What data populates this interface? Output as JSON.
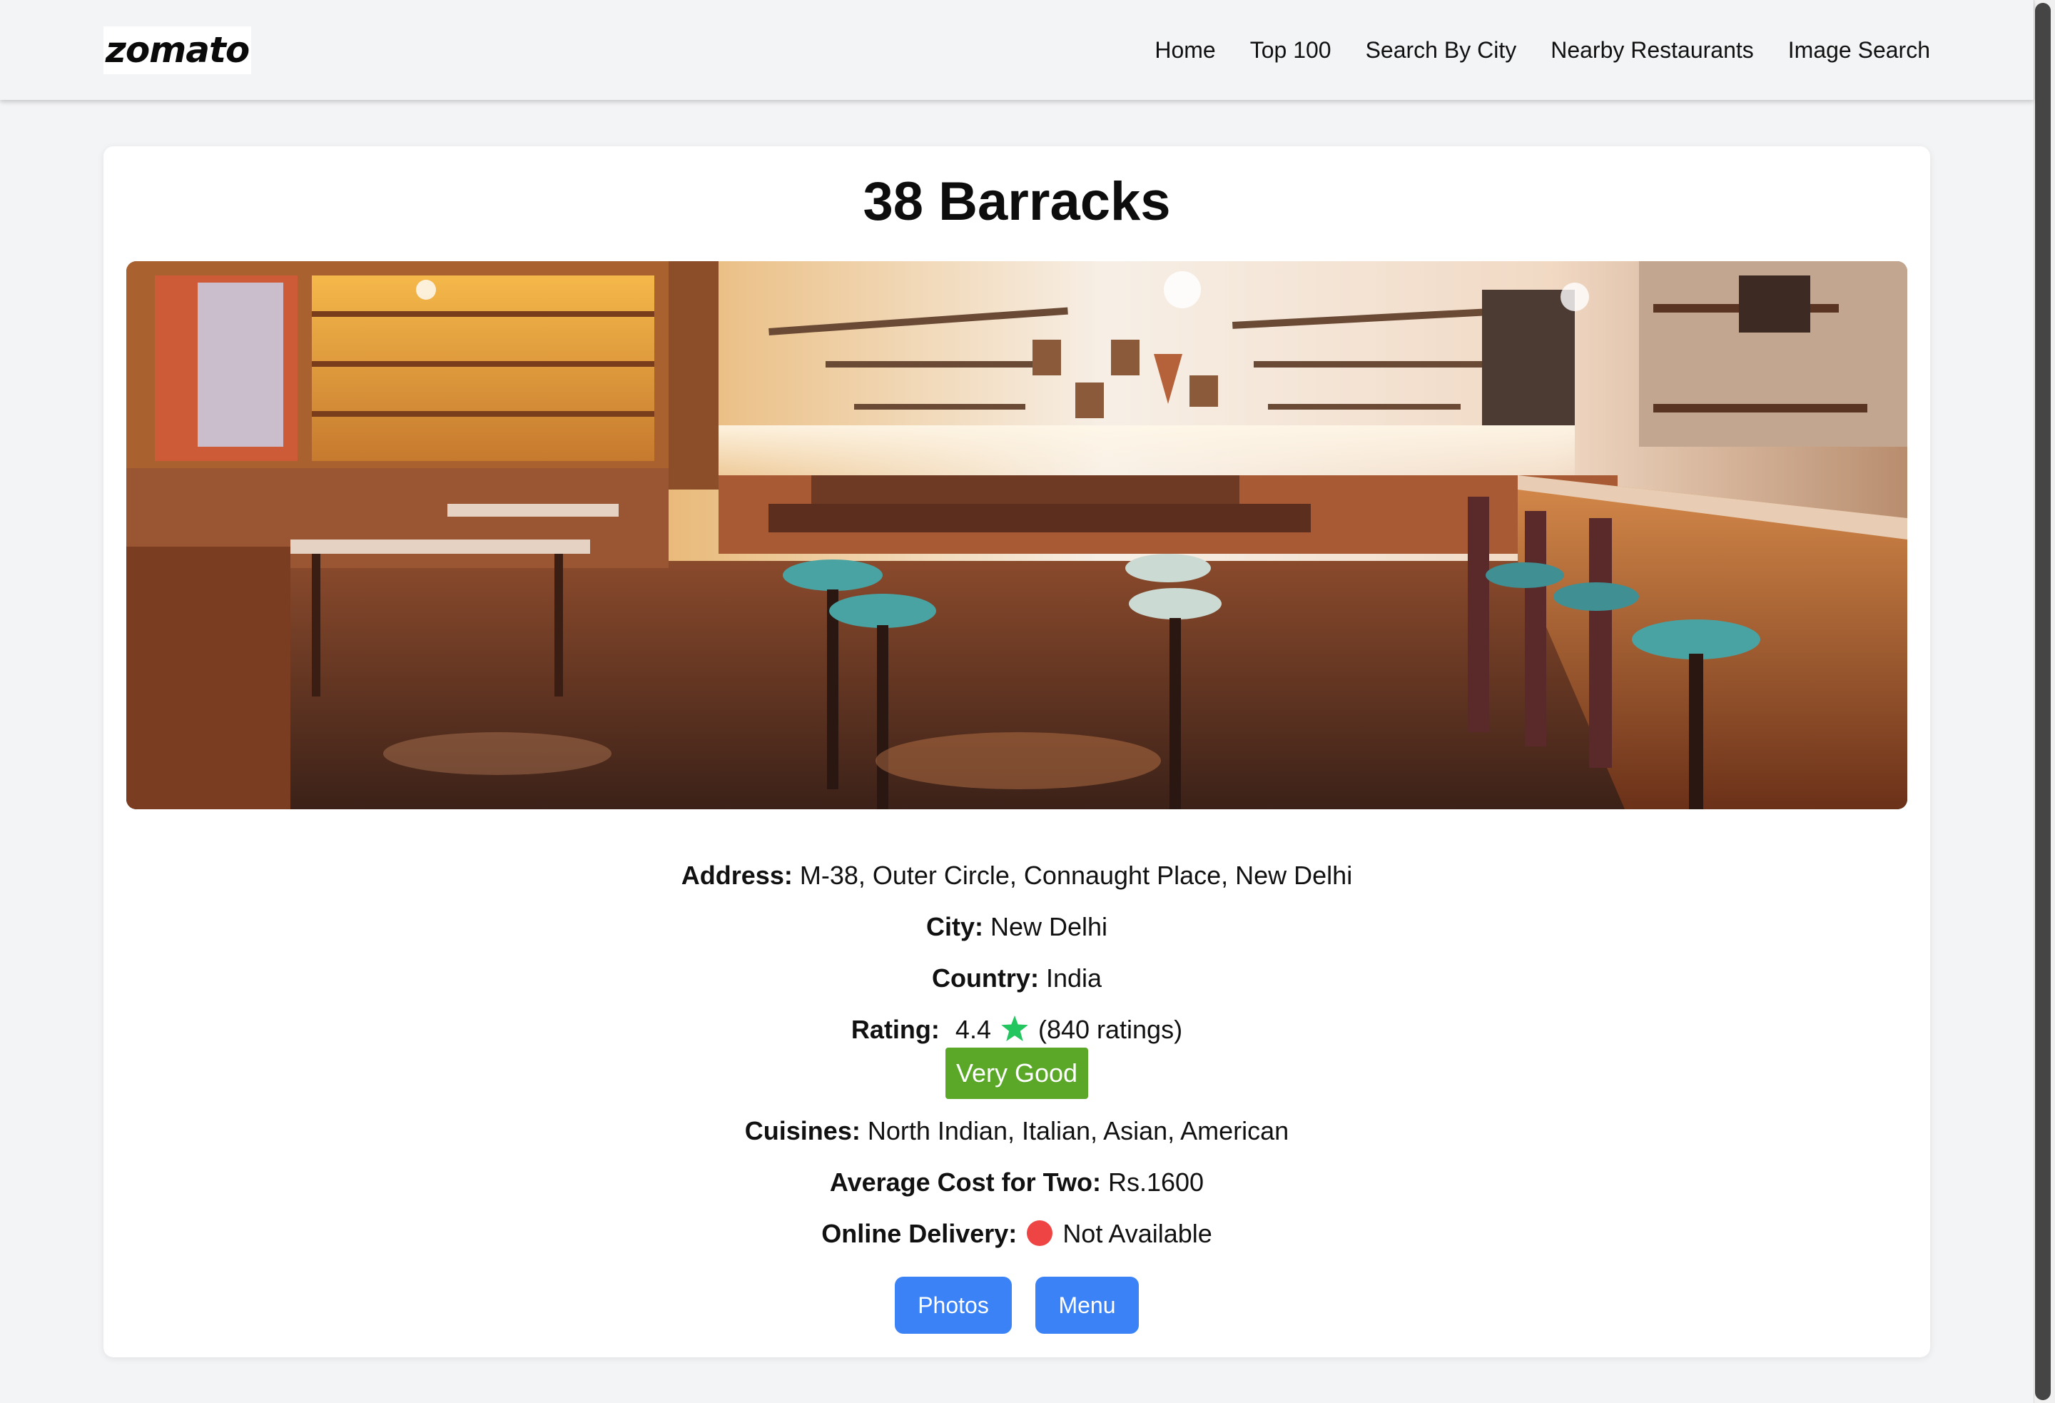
{
  "navbar": {
    "logo": "zomato",
    "links": [
      "Home",
      "Top 100",
      "Search By City",
      "Nearby Restaurants",
      "Image Search"
    ]
  },
  "restaurant": {
    "name": "38 Barracks",
    "address_label": "Address:",
    "address": "M-38, Outer Circle, Connaught Place, New Delhi",
    "city_label": "City:",
    "city": "New Delhi",
    "country_label": "Country:",
    "country": "India",
    "rating_label": "Rating:",
    "rating_value": "4.4",
    "rating_count": "(840 ratings)",
    "rating_text": "Very Good",
    "cuisines_label": "Cuisines:",
    "cuisines": "North Indian, Italian, Asian, American",
    "cost_label": "Average Cost for Two:",
    "cost": "Rs.1600",
    "delivery_label": "Online Delivery:",
    "delivery": "Not Available"
  },
  "actions": {
    "photos_label": "Photos",
    "menu_label": "Menu"
  },
  "colors": {
    "accent_button": "#3b82f6",
    "rating_badge": "#5ba829",
    "star": "#22c55e",
    "delivery_unavailable": "#ef4444"
  },
  "icons": {
    "rating": "star-icon",
    "delivery_status": "status-dot-icon"
  }
}
